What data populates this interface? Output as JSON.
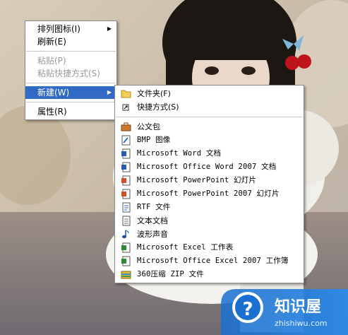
{
  "context_menu": {
    "items": [
      {
        "label": "排列图标(I)",
        "submenu": true
      },
      {
        "label": "刷新(E)"
      },
      {
        "label": "粘贴(P)",
        "disabled": true
      },
      {
        "label": "粘贴快捷方式(S)",
        "disabled": true
      },
      {
        "label": "新建(W)",
        "submenu": true,
        "highlighted": true
      },
      {
        "label": "属性(R)"
      }
    ],
    "arrow": "▶"
  },
  "new_submenu": {
    "items": [
      {
        "label": "文件夹(F)",
        "icon": "folder-icon"
      },
      {
        "label": "快捷方式(S)",
        "icon": "shortcut-icon"
      },
      {
        "label": "公文包",
        "icon": "briefcase-icon"
      },
      {
        "label": "BMP 图像",
        "icon": "bitmap-icon"
      },
      {
        "label": "Microsoft Word 文档",
        "icon": "word-doc-icon"
      },
      {
        "label": "Microsoft Office Word 2007 文档",
        "icon": "word-doc-icon"
      },
      {
        "label": "Microsoft PowerPoint 幻灯片",
        "icon": "powerpoint-icon"
      },
      {
        "label": "Microsoft PowerPoint 2007 幻灯片",
        "icon": "powerpoint-icon"
      },
      {
        "label": "RTF 文件",
        "icon": "rtf-doc-icon"
      },
      {
        "label": "文本文档",
        "icon": "text-doc-icon"
      },
      {
        "label": "波形声音",
        "icon": "sound-icon"
      },
      {
        "label": "Microsoft Excel 工作表",
        "icon": "excel-icon"
      },
      {
        "label": "Microsoft Office Excel 2007 工作簿",
        "icon": "excel-icon"
      },
      {
        "label": "360压缩 ZIP 文件",
        "icon": "zip-icon"
      }
    ]
  },
  "watermark": {
    "title": "知识屋",
    "url": "zhishiwu.com"
  },
  "colors": {
    "highlight": "#316ac5",
    "disabled": "#9a9a9a",
    "logo_blue": "#1a6fd0"
  }
}
